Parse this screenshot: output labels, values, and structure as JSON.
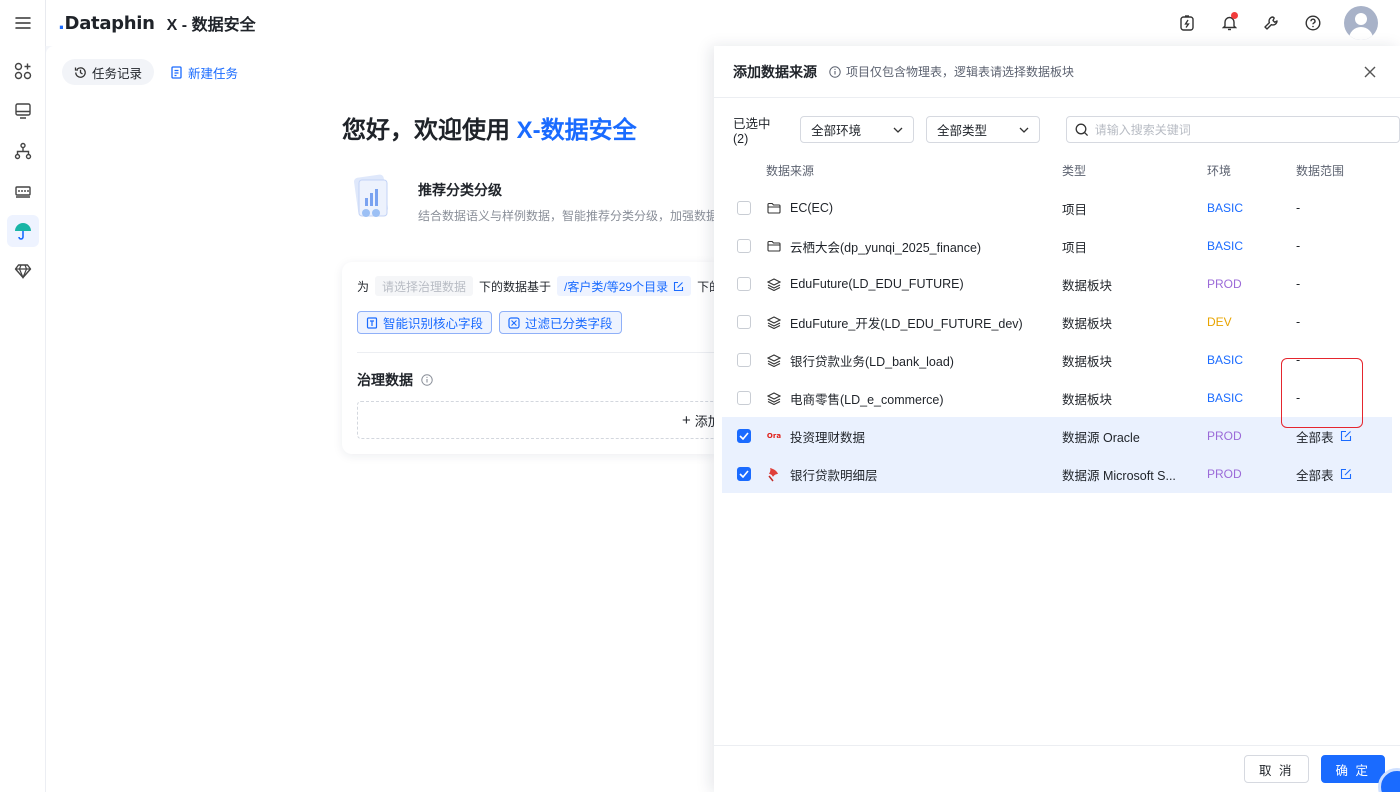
{
  "header": {
    "logo_text": "Dataphin",
    "app_title": "X - 数据安全"
  },
  "main": {
    "tabs": {
      "history": "任务记录",
      "new_task": "新建任务"
    },
    "welcome_prefix": "您好，欢迎使用",
    "welcome_brand": "X-数据安全",
    "recommend": {
      "title": "推荐分类分级",
      "desc": "结合数据语义与样例数据，智能推荐分类分级，加强数据安"
    },
    "rule": {
      "prefix": "为",
      "placeholder": "请选择治理数据",
      "middle": "下的数据基于",
      "path": "/客户类/等29个目录",
      "suffix": "下的数"
    },
    "chips": {
      "identify": "智能识别核心字段",
      "filter": "过滤已分类字段"
    },
    "governance_title": "治理数据",
    "add_label": "添加"
  },
  "drawer": {
    "title": "添加数据来源",
    "hint": "项目仅包含物理表，逻辑表请选择数据板块",
    "selected_count": "已选中 (2)",
    "env_select": "全部环境",
    "type_select": "全部类型",
    "search_placeholder": "请输入搜索关键词",
    "columns": {
      "source": "数据来源",
      "type": "类型",
      "env": "环境",
      "range": "数据范围"
    },
    "rows": [
      {
        "name": "EC(EC)",
        "type": "项目",
        "env": "BASIC",
        "range": "-"
      },
      {
        "name": "云栖大会(dp_yunqi_2025_finance)",
        "type": "项目",
        "env": "BASIC",
        "range": "-"
      },
      {
        "name": "EduFuture(LD_EDU_FUTURE)",
        "type": "数据板块",
        "env": "PROD",
        "range": "-"
      },
      {
        "name": "EduFuture_开发(LD_EDU_FUTURE_dev)",
        "type": "数据板块",
        "env": "DEV",
        "range": "-"
      },
      {
        "name": "银行贷款业务(LD_bank_load)",
        "type": "数据板块",
        "env": "BASIC",
        "range": "-"
      },
      {
        "name": "电商零售(LD_e_commerce)",
        "type": "数据板块",
        "env": "BASIC",
        "range": "-"
      },
      {
        "name": "投资理财数据",
        "type": "数据源  Oracle",
        "env": "PROD",
        "range": "全部表",
        "icon_text": "Ora"
      },
      {
        "name": "银行贷款明细层",
        "type": "数据源  Microsoft S...",
        "env": "PROD",
        "range": "全部表"
      }
    ],
    "cancel": "取 消",
    "confirm": "确 定"
  },
  "colors": {
    "accent": "#1a6bff",
    "prod": "#9b6ad8",
    "dev": "#e8a400",
    "highlight": "#e5262e"
  }
}
